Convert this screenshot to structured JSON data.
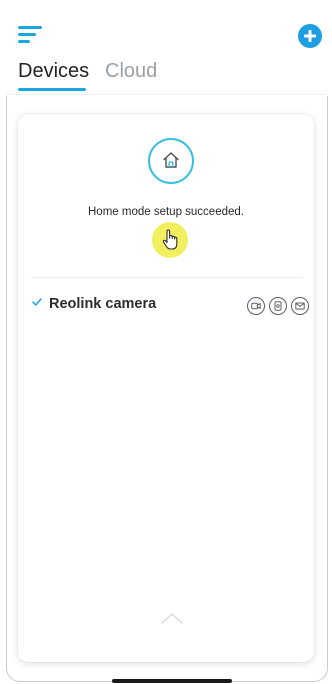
{
  "header": {
    "menu_icon": "hamburger-menu-icon",
    "add_icon": "plus-circle-icon",
    "accent_color": "#1aa6e0"
  },
  "tabs": [
    {
      "label": "Devices",
      "active": true
    },
    {
      "label": "Cloud",
      "active": false
    }
  ],
  "card": {
    "mode_icon": "home-icon",
    "success_message": "Home mode setup succeeded.",
    "devices": [
      {
        "name": "Reolink camera",
        "checked": true,
        "features": [
          "record-icon",
          "push-notification-icon",
          "email-icon"
        ]
      }
    ],
    "collapse_icon": "chevron-up-icon"
  }
}
